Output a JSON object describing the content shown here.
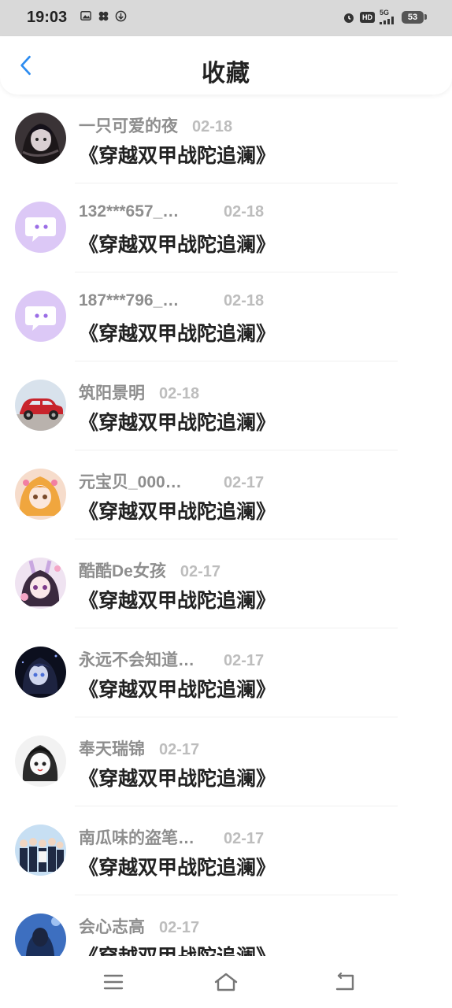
{
  "status_bar": {
    "time": "19:03",
    "network": "5G",
    "hd_label": "HD",
    "battery": "53"
  },
  "header": {
    "title": "收藏"
  },
  "items": [
    {
      "name": "一只可爱的夜",
      "date": "02-18",
      "title": "《穿越双甲战陀追澜》",
      "avatar": "dark-girl"
    },
    {
      "name": "132***657_…",
      "date": "02-18",
      "title": "《穿越双甲战陀追澜》",
      "avatar": "default-chat"
    },
    {
      "name": "187***796_…",
      "date": "02-18",
      "title": "《穿越双甲战陀追澜》",
      "avatar": "default-chat"
    },
    {
      "name": "筑阳景明",
      "date": "02-18",
      "title": "《穿越双甲战陀追澜》",
      "avatar": "red-car"
    },
    {
      "name": "元宝贝_000…",
      "date": "02-17",
      "title": "《穿越双甲战陀追澜》",
      "avatar": "anime-orange"
    },
    {
      "name": "酷酷De女孩",
      "date": "02-17",
      "title": "《穿越双甲战陀追澜》",
      "avatar": "anime-pink"
    },
    {
      "name": "永远不会知道…",
      "date": "02-17",
      "title": "《穿越双甲战陀追澜》",
      "avatar": "anime-dark"
    },
    {
      "name": "奉天瑞锦",
      "date": "02-17",
      "title": "《穿越双甲战陀追澜》",
      "avatar": "anime-sketch"
    },
    {
      "name": "南瓜味的盗笔…",
      "date": "02-17",
      "title": "《穿越双甲战陀追澜》",
      "avatar": "group-photo"
    },
    {
      "name": "会心志高",
      "date": "02-17",
      "title": "《穿越双甲战陀追澜》",
      "avatar": "blue-portrait"
    }
  ],
  "colors": {
    "accent": "#2d8cf0",
    "default_avatar": "#d8c4f5",
    "default_avatar_icon": "#9b6ee6"
  },
  "bottom_nav": {
    "menu_icon": "menu-icon",
    "home_icon": "home-icon",
    "back_icon": "back-nav-icon"
  }
}
